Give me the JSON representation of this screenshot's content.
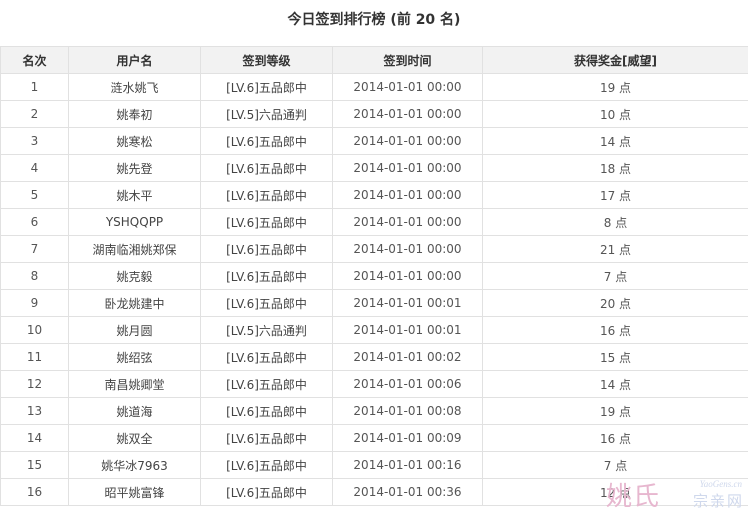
{
  "page": {
    "title": "今日签到排行榜 (前 20 名)"
  },
  "table": {
    "headers": [
      "名次",
      "用户名",
      "签到等级",
      "签到时间",
      "获得奖金[威望]"
    ],
    "rows": [
      [
        "1",
        "涟水姚飞",
        "[LV.6]五品郎中",
        "2014-01-01 00:00",
        "19 点"
      ],
      [
        "2",
        "姚奉初",
        "[LV.5]六品通判",
        "2014-01-01 00:00",
        "10 点"
      ],
      [
        "3",
        "姚寒松",
        "[LV.6]五品郎中",
        "2014-01-01 00:00",
        "14 点"
      ],
      [
        "4",
        "姚先登",
        "[LV.6]五品郎中",
        "2014-01-01 00:00",
        "18 点"
      ],
      [
        "5",
        "姚木平",
        "[LV.6]五品郎中",
        "2014-01-01 00:00",
        "17 点"
      ],
      [
        "6",
        "YSHQQPP",
        "[LV.6]五品郎中",
        "2014-01-01 00:00",
        "8 点"
      ],
      [
        "7",
        "湖南临湘姚郑保",
        "[LV.6]五品郎中",
        "2014-01-01 00:00",
        "21 点"
      ],
      [
        "8",
        "姚克毅",
        "[LV.6]五品郎中",
        "2014-01-01 00:00",
        "7 点"
      ],
      [
        "9",
        "卧龙姚建中",
        "[LV.6]五品郎中",
        "2014-01-01 00:01",
        "20 点"
      ],
      [
        "10",
        "姚月圆",
        "[LV.5]六品通判",
        "2014-01-01 00:01",
        "16 点"
      ],
      [
        "11",
        "姚绍弦",
        "[LV.6]五品郎中",
        "2014-01-01 00:02",
        "15 点"
      ],
      [
        "12",
        "南昌姚卿堂",
        "[LV.6]五品郎中",
        "2014-01-01 00:06",
        "14 点"
      ],
      [
        "13",
        "姚道海",
        "[LV.6]五品郎中",
        "2014-01-01 00:08",
        "19 点"
      ],
      [
        "14",
        "姚双全",
        "[LV.6]五品郎中",
        "2014-01-01 00:09",
        "16 点"
      ],
      [
        "15",
        "姚华冰7963",
        "[LV.6]五品郎中",
        "2014-01-01 00:16",
        "7 点"
      ],
      [
        "16",
        "昭平姚富锋",
        "[LV.6]五品郎中",
        "2014-01-01 00:36",
        "12 点"
      ]
    ]
  },
  "watermark": {
    "big": "姚氏",
    "small": "宗亲网",
    "url": "YaoGens.cn"
  }
}
